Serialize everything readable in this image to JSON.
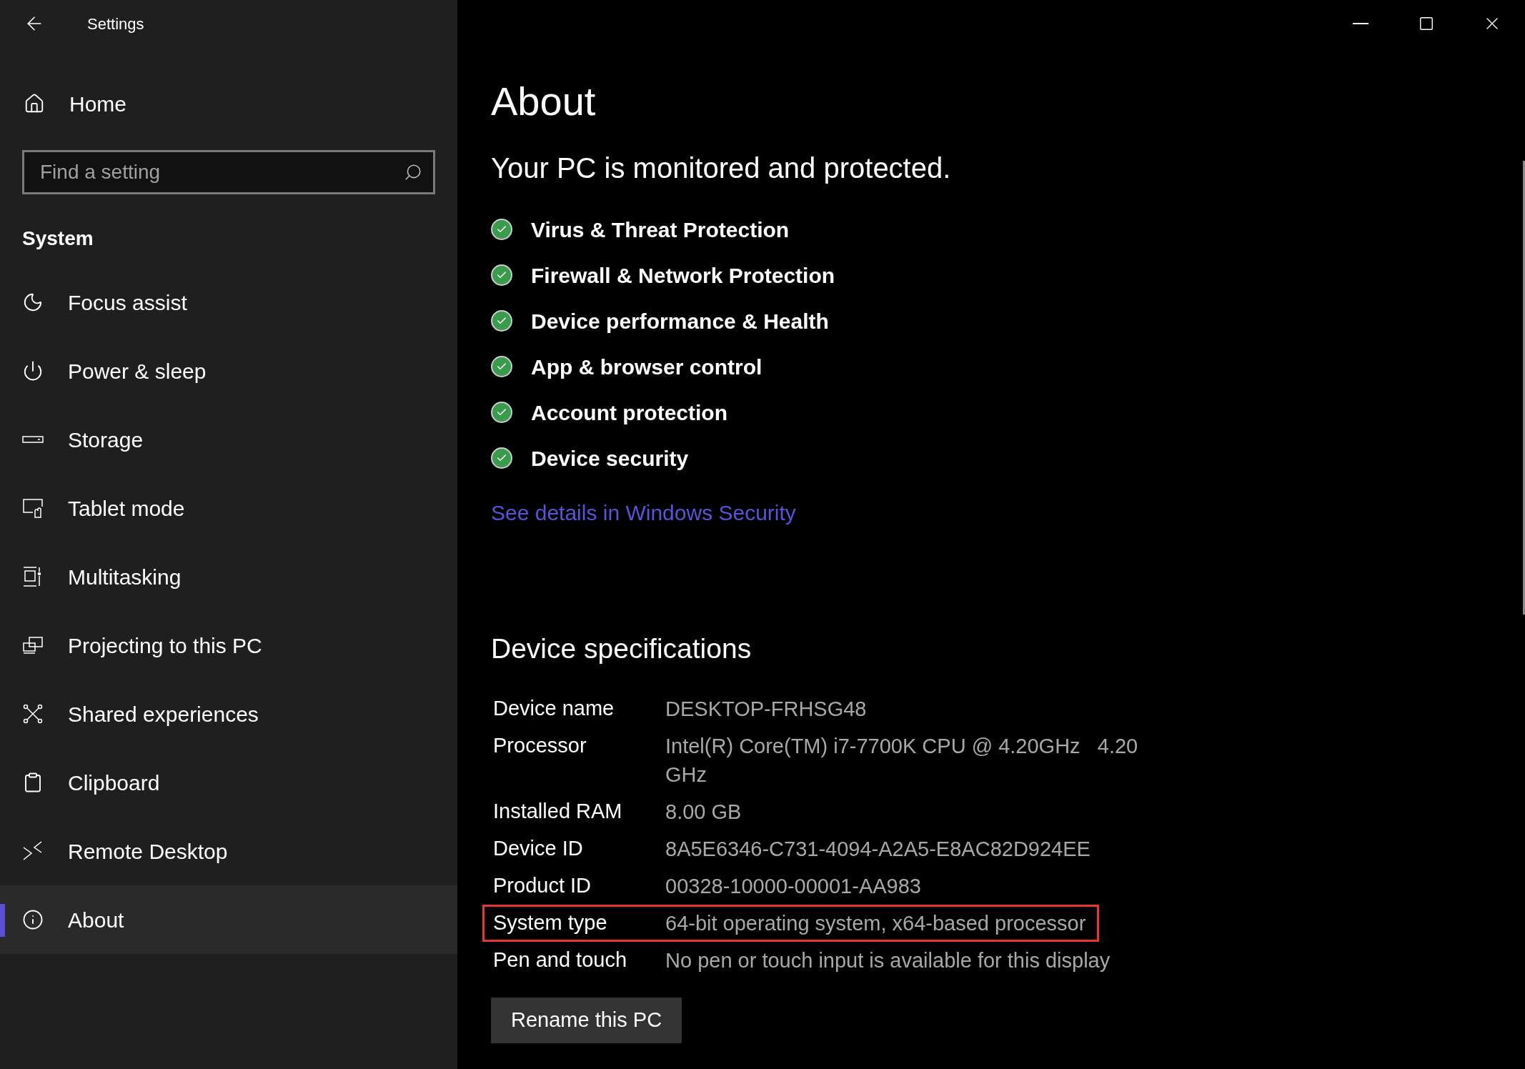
{
  "window": {
    "title": "Settings"
  },
  "sidebar": {
    "home": "Home",
    "search": {
      "placeholder": "Find a setting"
    },
    "section": "System",
    "items": [
      {
        "label": "Focus assist",
        "selected": false
      },
      {
        "label": "Power & sleep",
        "selected": false
      },
      {
        "label": "Storage",
        "selected": false
      },
      {
        "label": "Tablet mode",
        "selected": false
      },
      {
        "label": "Multitasking",
        "selected": false
      },
      {
        "label": "Projecting to this PC",
        "selected": false
      },
      {
        "label": "Shared experiences",
        "selected": false
      },
      {
        "label": "Clipboard",
        "selected": false
      },
      {
        "label": "Remote Desktop",
        "selected": false
      },
      {
        "label": "About",
        "selected": true
      }
    ]
  },
  "page": {
    "title": "About",
    "status": "Your PC is monitored and protected.",
    "protections": [
      {
        "label": "Virus & Threat Protection",
        "ok": true
      },
      {
        "label": "Firewall & Network Protection",
        "ok": true
      },
      {
        "label": "Device performance & Health",
        "ok": true
      },
      {
        "label": "App & browser control",
        "ok": true
      },
      {
        "label": "Account protection",
        "ok": true
      },
      {
        "label": "Device security",
        "ok": true
      }
    ],
    "link": "See details in Windows Security",
    "specs_title": "Device specifications",
    "specs": [
      {
        "label": "Device name",
        "value": "DESKTOP-FRHSG48",
        "highlighted": false
      },
      {
        "label": "Processor",
        "value": "Intel(R) Core(TM) i7-7700K CPU @ 4.20GHz   4.20 GHz",
        "highlighted": false
      },
      {
        "label": "Installed RAM",
        "value": "8.00 GB",
        "highlighted": false
      },
      {
        "label": "Device ID",
        "value": "8A5E6346-C731-4094-A2A5-E8AC82D924EE",
        "highlighted": false
      },
      {
        "label": "Product ID",
        "value": "00328-10000-00001-AA983",
        "highlighted": false
      },
      {
        "label": "System type",
        "value": "64-bit operating system, x64-based processor",
        "highlighted": true
      },
      {
        "label": "Pen and touch",
        "value": "No pen or touch input is available for this display",
        "highlighted": false
      }
    ],
    "button": "Rename this PC"
  }
}
